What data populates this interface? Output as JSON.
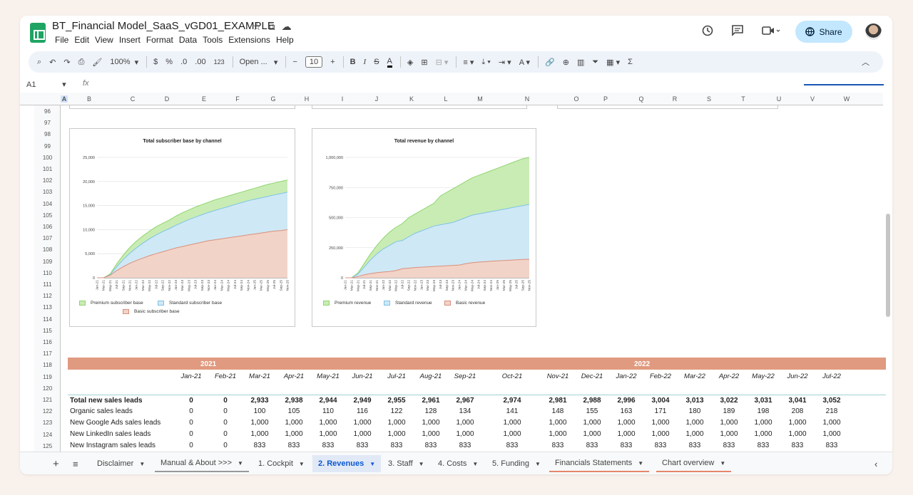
{
  "doc": {
    "title": "BT_Financial Model_SaaS_vGD01_EXAMPLE",
    "menu": [
      "File",
      "Edit",
      "View",
      "Insert",
      "Format",
      "Data",
      "Tools",
      "Extensions",
      "Help"
    ],
    "share_label": "Share",
    "icons": [
      "history-icon",
      "comment-icon",
      "video-call-icon",
      "globe-icon"
    ]
  },
  "toolbar": {
    "zoom": "100%",
    "currency": "$",
    "percent": "%",
    "dec_decrease": ".0",
    "dec_increase": ".00",
    "number_format": "123",
    "font": "Open ...",
    "font_size": "10",
    "minus": "−",
    "plus": "+"
  },
  "formula_bar": {
    "cell_ref": "A1",
    "fx": "fx"
  },
  "columns": [
    "A",
    "B",
    "C",
    "D",
    "E",
    "F",
    "G",
    "H",
    "I",
    "J",
    "K",
    "L",
    "M",
    "N",
    "O",
    "P",
    "Q",
    "R",
    "S",
    "T",
    "U",
    "V",
    "W"
  ],
  "rows": [
    "96",
    "97",
    "98",
    "99",
    "100",
    "101",
    "102",
    "103",
    "104",
    "105",
    "106",
    "107",
    "108",
    "109",
    "110",
    "111",
    "112",
    "113",
    "114",
    "115",
    "116",
    "117",
    "118",
    "119",
    "120",
    "121",
    "122",
    "123",
    "124",
    "125"
  ],
  "charts": {
    "subscribers": {
      "title": "Total subscriber base by channel",
      "yticks": [
        "25,000",
        "20,000",
        "15,000",
        "10,000",
        "5,000",
        "0"
      ],
      "legend": [
        "Premium subscriber base",
        "Standard subscriber base",
        "Basic subscriber base"
      ]
    },
    "revenue": {
      "title": "Total revenue by channel",
      "yticks": [
        "1,000,000",
        "750,000",
        "500,000",
        "250,000",
        "0"
      ],
      "legend": [
        "Premium revenue",
        "Standard revenue",
        "Basic revenue"
      ]
    },
    "xticks": [
      "Jan-21",
      "Mar-21",
      "May-21",
      "Jul-21",
      "Sep-21",
      "Nov-21",
      "Jan-22",
      "Mar-22",
      "May-22",
      "Jul-22",
      "Sep-22",
      "Nov-22",
      "Jan-23",
      "Mar-23",
      "May-23",
      "Jul-23",
      "Sep-23",
      "Nov-23",
      "Jan-24",
      "Mar-24",
      "May-24",
      "Jul-24",
      "Sep-24",
      "Nov-24",
      "Jan-25",
      "Mar-25",
      "May-25",
      "Jul-25",
      "Sep-25",
      "Nov-25"
    ],
    "colors": {
      "premium": "#c9ecb4",
      "standard": "#cfe8f5",
      "basic": "#f2d3c7",
      "premium_line": "#8fd46f",
      "standard_line": "#7ec3e6",
      "basic_line": "#d9907c"
    }
  },
  "chart_data": [
    {
      "type": "area",
      "title": "Total subscriber base by channel",
      "x": [
        "Jan-21",
        "Mar-21",
        "May-21",
        "Jul-21",
        "Sep-21",
        "Nov-21",
        "Jan-22",
        "Mar-22",
        "May-22",
        "Jul-22",
        "Sep-22",
        "Nov-22",
        "Jan-23",
        "Mar-23",
        "May-23",
        "Jul-23",
        "Sep-23",
        "Nov-23",
        "Jan-24",
        "Mar-24",
        "May-24",
        "Jul-24",
        "Sep-24",
        "Nov-24",
        "Jan-25",
        "Mar-25",
        "May-25",
        "Jul-25",
        "Sep-25",
        "Nov-25"
      ],
      "stacked_totals": true,
      "ylim": [
        0,
        25000
      ],
      "series": [
        {
          "name": "Premium subscriber base",
          "values": [
            0,
            0,
            800,
            2900,
            4700,
            6300,
            7600,
            8700,
            9700,
            10600,
            11300,
            12000,
            12800,
            13500,
            14100,
            14700,
            15200,
            15700,
            16200,
            16600,
            17000,
            17400,
            17800,
            18200,
            18600,
            19000,
            19400,
            19700,
            20000,
            20300
          ]
        },
        {
          "name": "Standard subscriber base",
          "values": [
            0,
            0,
            600,
            2300,
            3800,
            5100,
            6200,
            7200,
            8100,
            8900,
            9600,
            10200,
            10900,
            11500,
            12100,
            12600,
            13100,
            13600,
            14000,
            14400,
            14800,
            15200,
            15600,
            16000,
            16300,
            16600,
            16900,
            17200,
            17500,
            17800
          ]
        },
        {
          "name": "Basic subscriber base",
          "values": [
            0,
            0,
            500,
            1500,
            2300,
            3000,
            3600,
            4100,
            4600,
            5000,
            5400,
            5800,
            6200,
            6500,
            6800,
            7100,
            7400,
            7700,
            7900,
            8100,
            8300,
            8500,
            8700,
            8900,
            9100,
            9300,
            9500,
            9700,
            9800,
            10000
          ]
        }
      ]
    },
    {
      "type": "area",
      "title": "Total revenue by channel",
      "x": [
        "Jan-21",
        "Mar-21",
        "May-21",
        "Jul-21",
        "Sep-21",
        "Nov-21",
        "Jan-22",
        "Mar-22",
        "May-22",
        "Jul-22",
        "Sep-22",
        "Nov-22",
        "Jan-23",
        "Mar-23",
        "May-23",
        "Jul-23",
        "Sep-23",
        "Nov-23",
        "Jan-24",
        "Mar-24",
        "May-24",
        "Jul-24",
        "Sep-24",
        "Nov-24",
        "Jan-25",
        "Mar-25",
        "May-25",
        "Jul-25",
        "Sep-25",
        "Nov-25"
      ],
      "stacked_totals": true,
      "ylim": [
        0,
        1000000
      ],
      "series": [
        {
          "name": "Premium revenue",
          "values": [
            0,
            0,
            40000,
            120000,
            200000,
            270000,
            330000,
            380000,
            420000,
            450000,
            500000,
            530000,
            560000,
            590000,
            620000,
            680000,
            710000,
            740000,
            770000,
            800000,
            830000,
            850000,
            870000,
            890000,
            910000,
            930000,
            950000,
            970000,
            990000,
            1000000
          ]
        },
        {
          "name": "Standard revenue",
          "values": [
            0,
            0,
            30000,
            90000,
            150000,
            200000,
            240000,
            270000,
            300000,
            310000,
            340000,
            370000,
            390000,
            410000,
            430000,
            440000,
            450000,
            460000,
            480000,
            500000,
            520000,
            530000,
            540000,
            550000,
            560000,
            570000,
            580000,
            590000,
            600000,
            610000
          ]
        },
        {
          "name": "Basic revenue",
          "values": [
            0,
            0,
            10000,
            25000,
            35000,
            42000,
            48000,
            52000,
            60000,
            75000,
            80000,
            85000,
            88000,
            91000,
            94000,
            97000,
            100000,
            103000,
            106000,
            118000,
            125000,
            130000,
            134000,
            138000,
            141000,
            144000,
            147000,
            150000,
            152000,
            154000
          ]
        }
      ]
    }
  ],
  "table": {
    "year_2021": "2021",
    "year_2022": "2022",
    "months": [
      "Jan-21",
      "Feb-21",
      "Mar-21",
      "Apr-21",
      "May-21",
      "Jun-21",
      "Jul-21",
      "Aug-21",
      "Sep-21",
      "Oct-21",
      "Nov-21",
      "Dec-21",
      "Jan-22",
      "Feb-22",
      "Mar-22",
      "Apr-22",
      "May-22",
      "Jun-22",
      "Jul-22"
    ],
    "rows": [
      {
        "label": "Total new sales leads",
        "bold": true,
        "values": [
          "0",
          "0",
          "2,933",
          "2,938",
          "2,944",
          "2,949",
          "2,955",
          "2,961",
          "2,967",
          "2,974",
          "2,981",
          "2,988",
          "2,996",
          "3,004",
          "3,013",
          "3,022",
          "3,031",
          "3,041",
          "3,052"
        ]
      },
      {
        "label": "Organic sales leads",
        "bold": false,
        "values": [
          "0",
          "0",
          "100",
          "105",
          "110",
          "116",
          "122",
          "128",
          "134",
          "141",
          "148",
          "155",
          "163",
          "171",
          "180",
          "189",
          "198",
          "208",
          "218"
        ]
      },
      {
        "label": "New Google Ads sales leads",
        "bold": false,
        "values": [
          "0",
          "0",
          "1,000",
          "1,000",
          "1,000",
          "1,000",
          "1,000",
          "1,000",
          "1,000",
          "1,000",
          "1,000",
          "1,000",
          "1,000",
          "1,000",
          "1,000",
          "1,000",
          "1,000",
          "1,000",
          "1,000"
        ]
      },
      {
        "label": "New LinkedIn sales leads",
        "bold": false,
        "values": [
          "0",
          "0",
          "1,000",
          "1,000",
          "1,000",
          "1,000",
          "1,000",
          "1,000",
          "1,000",
          "1,000",
          "1,000",
          "1,000",
          "1,000",
          "1,000",
          "1,000",
          "1,000",
          "1,000",
          "1,000",
          "1,000"
        ]
      },
      {
        "label": "New Instagram sales leads",
        "bold": false,
        "values": [
          "0",
          "0",
          "833",
          "833",
          "833",
          "833",
          "833",
          "833",
          "833",
          "833",
          "833",
          "833",
          "833",
          "833",
          "833",
          "833",
          "833",
          "833",
          "833"
        ]
      }
    ]
  },
  "tabs": [
    "Disclaimer",
    "Manual & About >>>",
    "1. Cockpit",
    "2. Revenues",
    "3. Staff",
    "4. Costs",
    "5. Funding",
    "Financials Statements",
    "Chart overview"
  ],
  "active_tab": "2. Revenues"
}
